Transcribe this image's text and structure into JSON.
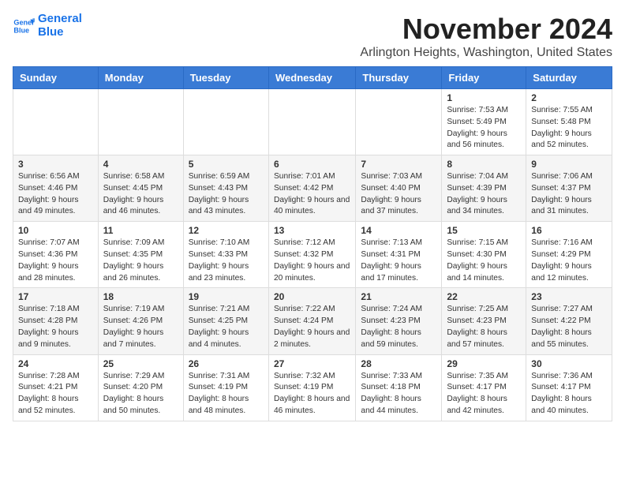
{
  "logo": {
    "line1": "General",
    "line2": "Blue"
  },
  "title": "November 2024",
  "location": "Arlington Heights, Washington, United States",
  "weekdays": [
    "Sunday",
    "Monday",
    "Tuesday",
    "Wednesday",
    "Thursday",
    "Friday",
    "Saturday"
  ],
  "weeks": [
    [
      {
        "day": "",
        "info": ""
      },
      {
        "day": "",
        "info": ""
      },
      {
        "day": "",
        "info": ""
      },
      {
        "day": "",
        "info": ""
      },
      {
        "day": "",
        "info": ""
      },
      {
        "day": "1",
        "info": "Sunrise: 7:53 AM\nSunset: 5:49 PM\nDaylight: 9 hours and 56 minutes."
      },
      {
        "day": "2",
        "info": "Sunrise: 7:55 AM\nSunset: 5:48 PM\nDaylight: 9 hours and 52 minutes."
      }
    ],
    [
      {
        "day": "3",
        "info": "Sunrise: 6:56 AM\nSunset: 4:46 PM\nDaylight: 9 hours and 49 minutes."
      },
      {
        "day": "4",
        "info": "Sunrise: 6:58 AM\nSunset: 4:45 PM\nDaylight: 9 hours and 46 minutes."
      },
      {
        "day": "5",
        "info": "Sunrise: 6:59 AM\nSunset: 4:43 PM\nDaylight: 9 hours and 43 minutes."
      },
      {
        "day": "6",
        "info": "Sunrise: 7:01 AM\nSunset: 4:42 PM\nDaylight: 9 hours and 40 minutes."
      },
      {
        "day": "7",
        "info": "Sunrise: 7:03 AM\nSunset: 4:40 PM\nDaylight: 9 hours and 37 minutes."
      },
      {
        "day": "8",
        "info": "Sunrise: 7:04 AM\nSunset: 4:39 PM\nDaylight: 9 hours and 34 minutes."
      },
      {
        "day": "9",
        "info": "Sunrise: 7:06 AM\nSunset: 4:37 PM\nDaylight: 9 hours and 31 minutes."
      }
    ],
    [
      {
        "day": "10",
        "info": "Sunrise: 7:07 AM\nSunset: 4:36 PM\nDaylight: 9 hours and 28 minutes."
      },
      {
        "day": "11",
        "info": "Sunrise: 7:09 AM\nSunset: 4:35 PM\nDaylight: 9 hours and 26 minutes."
      },
      {
        "day": "12",
        "info": "Sunrise: 7:10 AM\nSunset: 4:33 PM\nDaylight: 9 hours and 23 minutes."
      },
      {
        "day": "13",
        "info": "Sunrise: 7:12 AM\nSunset: 4:32 PM\nDaylight: 9 hours and 20 minutes."
      },
      {
        "day": "14",
        "info": "Sunrise: 7:13 AM\nSunset: 4:31 PM\nDaylight: 9 hours and 17 minutes."
      },
      {
        "day": "15",
        "info": "Sunrise: 7:15 AM\nSunset: 4:30 PM\nDaylight: 9 hours and 14 minutes."
      },
      {
        "day": "16",
        "info": "Sunrise: 7:16 AM\nSunset: 4:29 PM\nDaylight: 9 hours and 12 minutes."
      }
    ],
    [
      {
        "day": "17",
        "info": "Sunrise: 7:18 AM\nSunset: 4:28 PM\nDaylight: 9 hours and 9 minutes."
      },
      {
        "day": "18",
        "info": "Sunrise: 7:19 AM\nSunset: 4:26 PM\nDaylight: 9 hours and 7 minutes."
      },
      {
        "day": "19",
        "info": "Sunrise: 7:21 AM\nSunset: 4:25 PM\nDaylight: 9 hours and 4 minutes."
      },
      {
        "day": "20",
        "info": "Sunrise: 7:22 AM\nSunset: 4:24 PM\nDaylight: 9 hours and 2 minutes."
      },
      {
        "day": "21",
        "info": "Sunrise: 7:24 AM\nSunset: 4:23 PM\nDaylight: 8 hours and 59 minutes."
      },
      {
        "day": "22",
        "info": "Sunrise: 7:25 AM\nSunset: 4:23 PM\nDaylight: 8 hours and 57 minutes."
      },
      {
        "day": "23",
        "info": "Sunrise: 7:27 AM\nSunset: 4:22 PM\nDaylight: 8 hours and 55 minutes."
      }
    ],
    [
      {
        "day": "24",
        "info": "Sunrise: 7:28 AM\nSunset: 4:21 PM\nDaylight: 8 hours and 52 minutes."
      },
      {
        "day": "25",
        "info": "Sunrise: 7:29 AM\nSunset: 4:20 PM\nDaylight: 8 hours and 50 minutes."
      },
      {
        "day": "26",
        "info": "Sunrise: 7:31 AM\nSunset: 4:19 PM\nDaylight: 8 hours and 48 minutes."
      },
      {
        "day": "27",
        "info": "Sunrise: 7:32 AM\nSunset: 4:19 PM\nDaylight: 8 hours and 46 minutes."
      },
      {
        "day": "28",
        "info": "Sunrise: 7:33 AM\nSunset: 4:18 PM\nDaylight: 8 hours and 44 minutes."
      },
      {
        "day": "29",
        "info": "Sunrise: 7:35 AM\nSunset: 4:17 PM\nDaylight: 8 hours and 42 minutes."
      },
      {
        "day": "30",
        "info": "Sunrise: 7:36 AM\nSunset: 4:17 PM\nDaylight: 8 hours and 40 minutes."
      }
    ]
  ]
}
